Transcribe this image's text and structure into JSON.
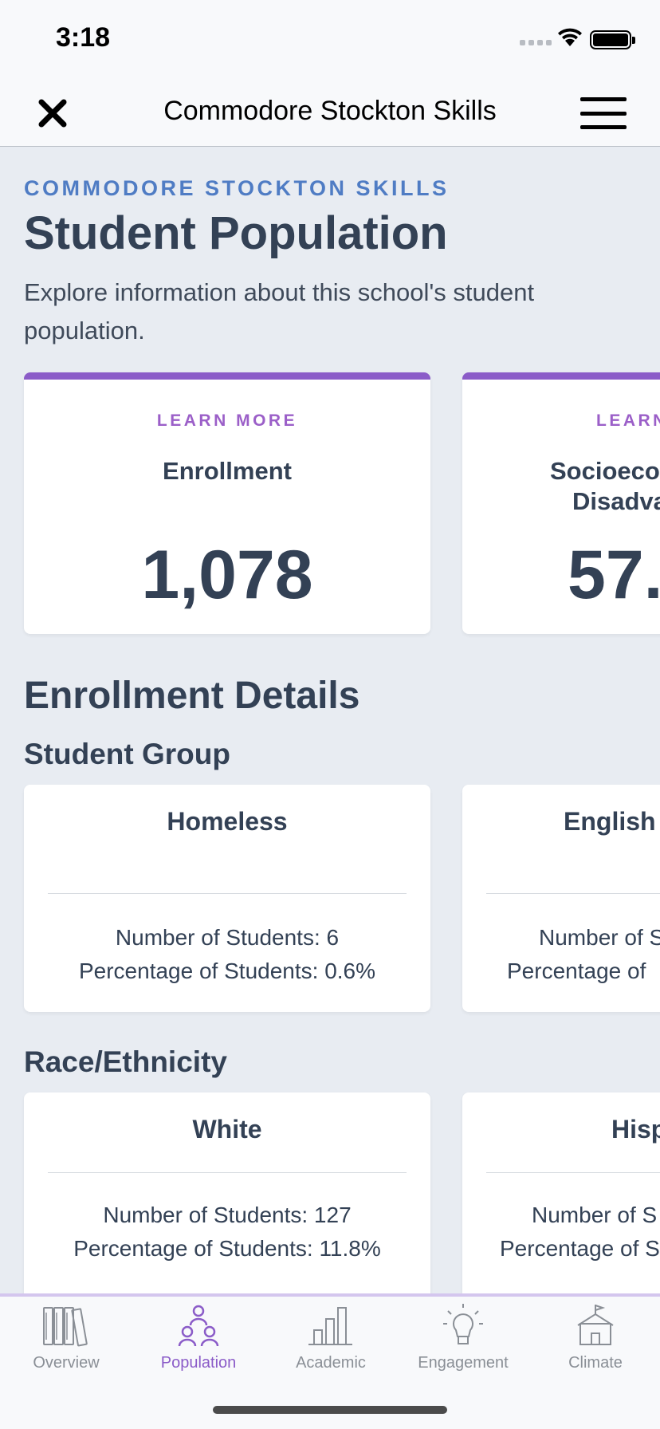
{
  "status_bar": {
    "time": "3:18"
  },
  "nav": {
    "title": "Commodore Stockton Skills"
  },
  "header": {
    "eyebrow": "COMMODORE STOCKTON SKILLS",
    "title": "Student Population",
    "description": "Explore information about this school's student population."
  },
  "stat_cards": [
    {
      "learn_more": "LEARN MORE",
      "label": "Enrollment",
      "value": "1,078"
    },
    {
      "learn_more": "LEARN",
      "label_line1": "Socioeco",
      "label_line2": "Disadva",
      "value": "57."
    }
  ],
  "enrollment_details": {
    "title": "Enrollment Details",
    "student_group": {
      "title": "Student Group",
      "cards": [
        {
          "name": "Homeless",
          "number": "Number of Students: 6",
          "percentage": "Percentage of Students: 0.6%"
        },
        {
          "name": "English",
          "number": "Number of S",
          "percentage": "Percentage of"
        }
      ]
    },
    "race_ethnicity": {
      "title": "Race/Ethnicity",
      "cards": [
        {
          "name": "White",
          "number": "Number of Students: 127",
          "percentage": "Percentage of Students: 11.8%"
        },
        {
          "name": "Hisp",
          "number": "Number of S",
          "percentage": "Percentage of S"
        }
      ]
    }
  },
  "tabs": [
    {
      "label": "Overview",
      "icon": "books-icon",
      "active": false
    },
    {
      "label": "Population",
      "icon": "people-icon",
      "active": true
    },
    {
      "label": "Academic",
      "icon": "bar-chart-icon",
      "active": false
    },
    {
      "label": "Engagement",
      "icon": "lightbulb-icon",
      "active": false
    },
    {
      "label": "Climate",
      "icon": "school-icon",
      "active": false
    }
  ],
  "colors": {
    "accent": "#8b5cc8",
    "eyebrow": "#4f7cc4",
    "text": "#334155",
    "background": "#e8ecf2"
  }
}
